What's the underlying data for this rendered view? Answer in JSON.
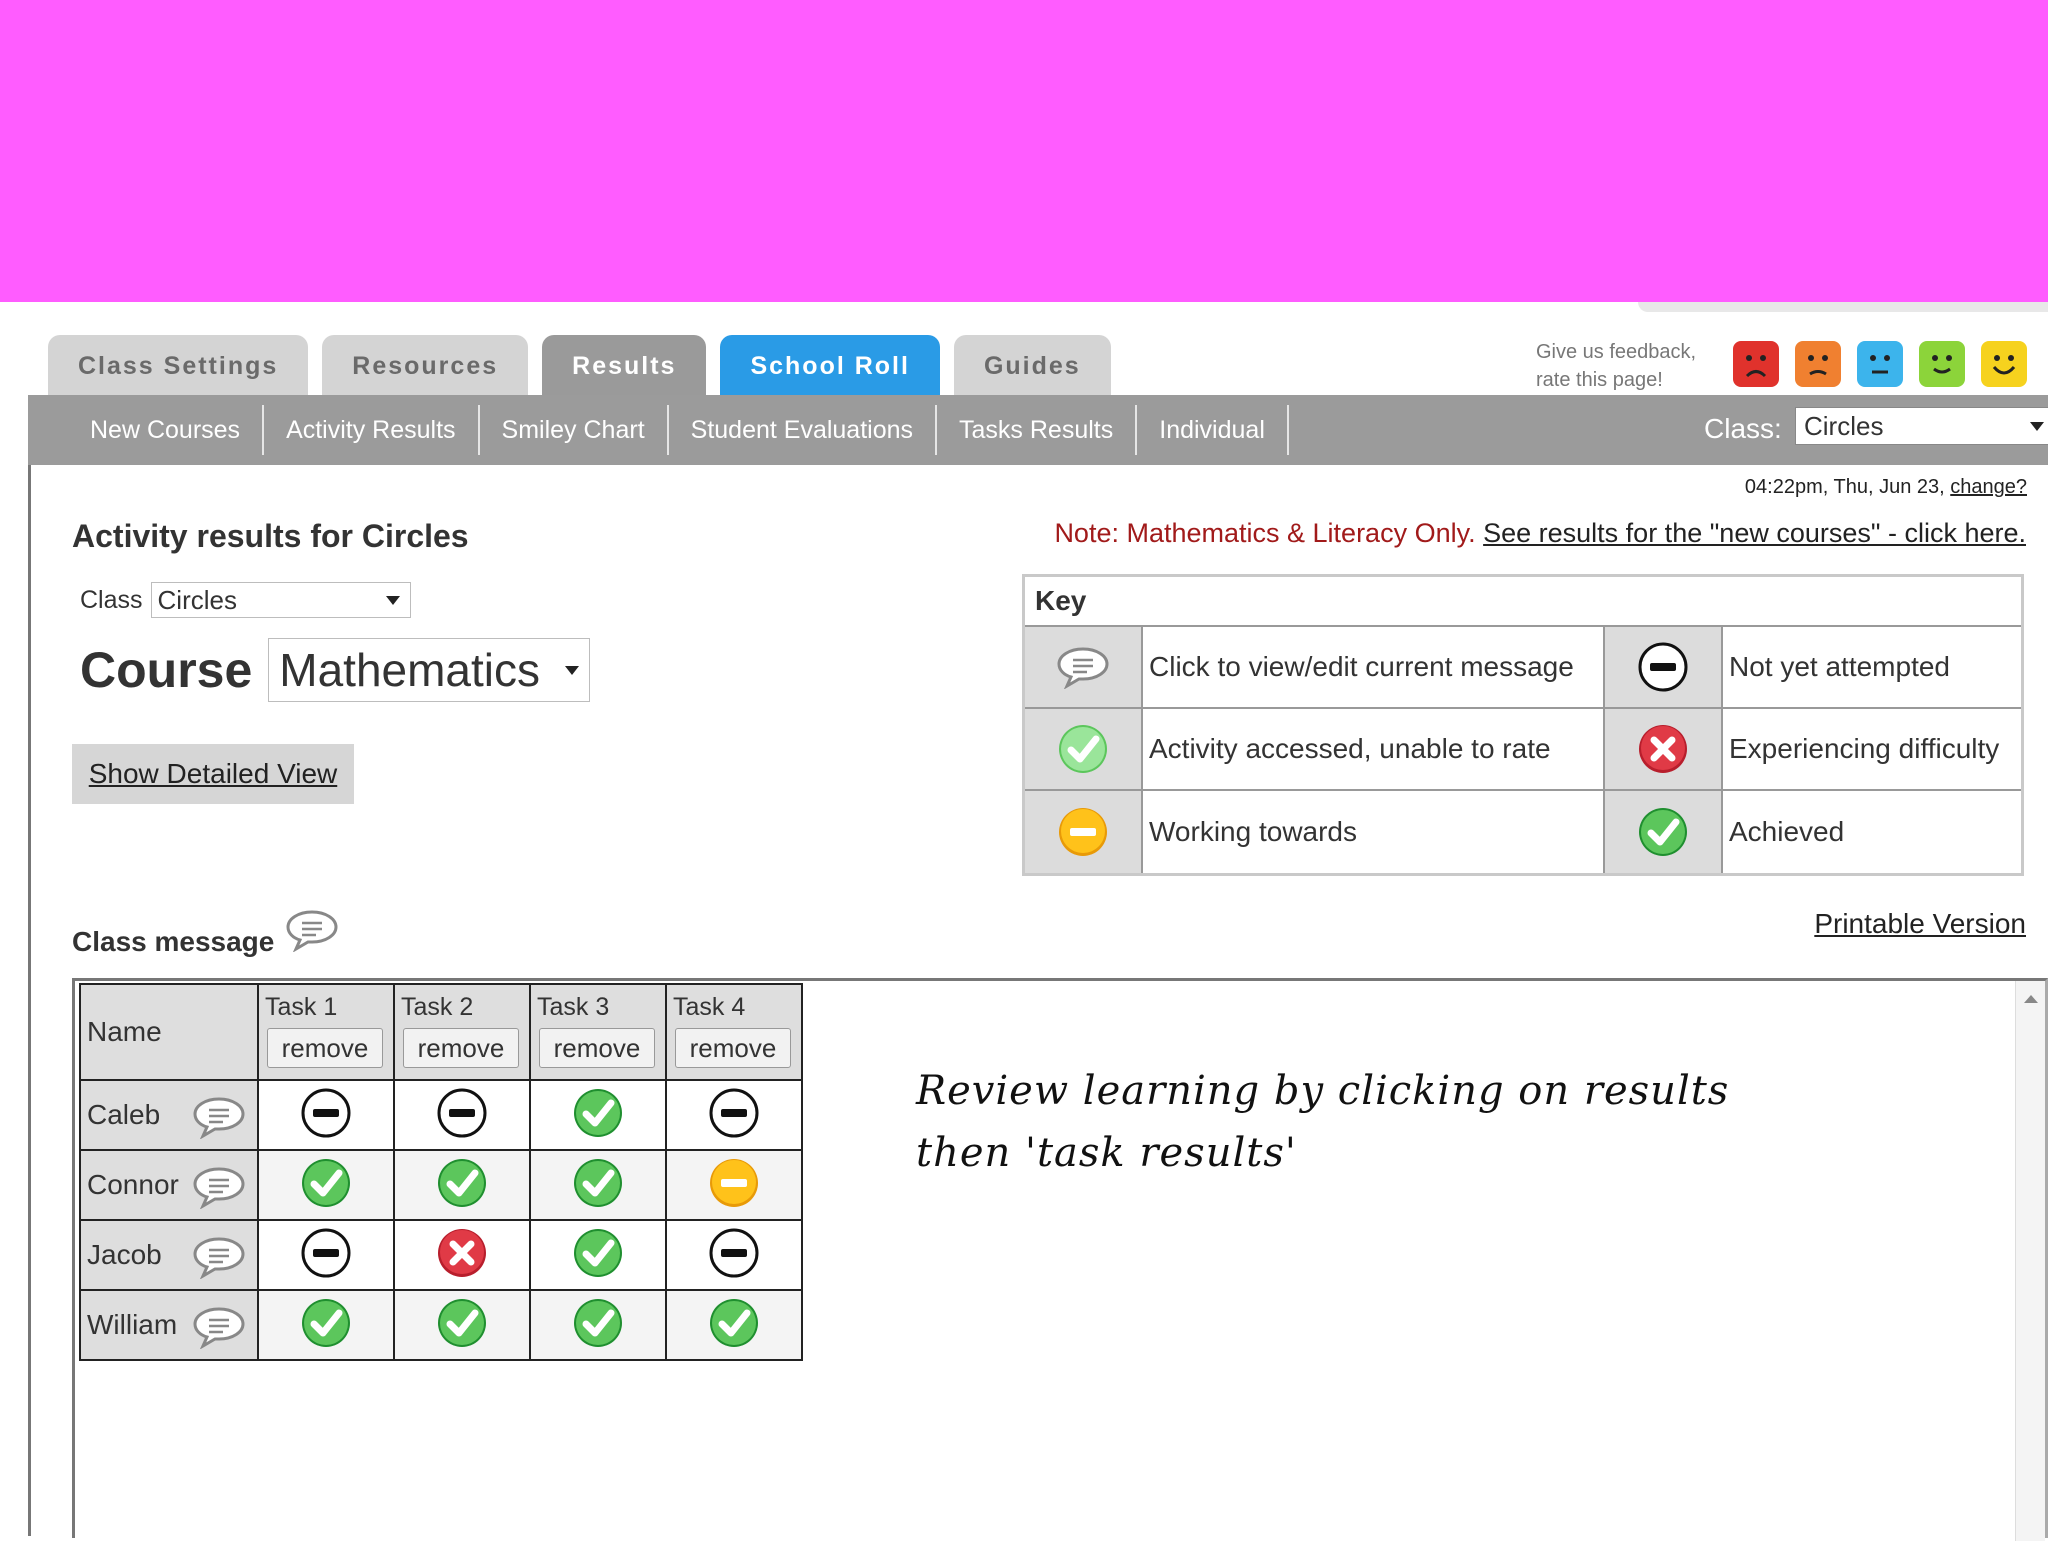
{
  "tabs": [
    {
      "label": "Class Settings"
    },
    {
      "label": "Resources"
    },
    {
      "label": "Results"
    },
    {
      "label": "School Roll"
    },
    {
      "label": "Guides"
    }
  ],
  "feedback": {
    "line1": "Give us feedback,",
    "line2": "rate this page!"
  },
  "smileys": [
    {
      "icon": "very-unhappy-face-icon",
      "color": "#e0322c"
    },
    {
      "icon": "unhappy-face-icon",
      "color": "#f08030"
    },
    {
      "icon": "neutral-face-icon",
      "color": "#3cb4ec"
    },
    {
      "icon": "happy-face-icon",
      "color": "#8cd43a"
    },
    {
      "icon": "very-happy-face-icon",
      "color": "#f6d21e"
    }
  ],
  "subnav": {
    "items": [
      "New Courses",
      "Activity Results",
      "Smiley Chart",
      "Student Evaluations",
      "Tasks Results",
      "Individual"
    ],
    "class_label": "Class:",
    "class_value": "Circles"
  },
  "timestamp": {
    "text": "04:22pm, Thu, Jun 23,",
    "link": "change?"
  },
  "page_title": "Activity results for Circles",
  "note": {
    "prefix": "Note: Mathematics & Literacy Only.",
    "link": "See results for the \"new courses\" - click here."
  },
  "class_filter": {
    "label": "Class",
    "value": "Circles"
  },
  "course_filter": {
    "label": "Course",
    "value": "Mathematics"
  },
  "detail_button": "Show Detailed View",
  "key": {
    "title": "Key",
    "rows": [
      {
        "left": "Click to view/edit current message",
        "right": "Not yet attempted"
      },
      {
        "left": "Activity accessed, unable to rate",
        "right": "Experiencing difficulty"
      },
      {
        "left": "Working towards",
        "right": "Achieved"
      }
    ]
  },
  "class_message_label": "Class message",
  "printable": "Printable Version",
  "results": {
    "name_header": "Name",
    "remove_label": "remove",
    "tasks": [
      "Task 1",
      "Task 2",
      "Task 3",
      "Task 4"
    ],
    "students": [
      {
        "name": "Caleb",
        "status": [
          "not-attempted",
          "not-attempted",
          "achieved",
          "not-attempted"
        ]
      },
      {
        "name": "Connor",
        "status": [
          "achieved",
          "achieved",
          "achieved",
          "working-towards"
        ]
      },
      {
        "name": "Jacob",
        "status": [
          "not-attempted",
          "difficulty",
          "achieved",
          "not-attempted"
        ]
      },
      {
        "name": "William",
        "status": [
          "achieved",
          "achieved",
          "achieved",
          "achieved"
        ]
      }
    ]
  },
  "handwritten_note": {
    "line1": "Review learning by clicking on results",
    "line2": "then 'task results'"
  },
  "colors": {
    "banner": "#ff5cff",
    "active_tab": "#2a9be6",
    "subnav": "#9b9b9b",
    "note_red": "#a11a1a"
  }
}
